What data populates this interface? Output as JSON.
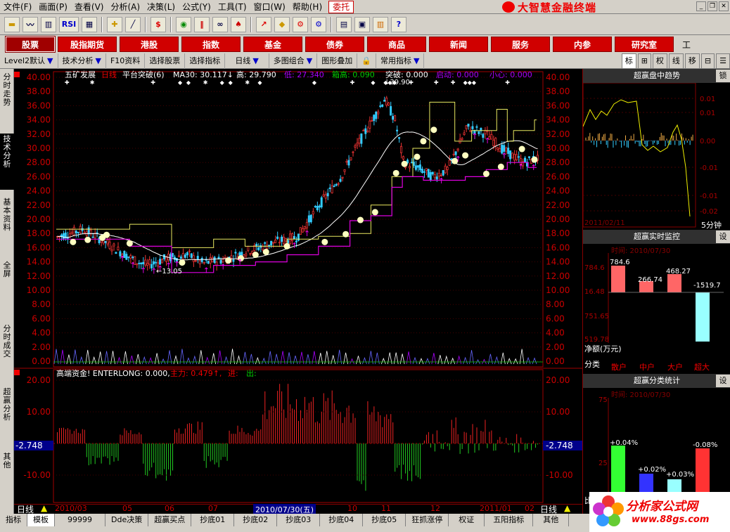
{
  "menu": {
    "items": [
      "文件(F)",
      "画面(P)",
      "查看(V)",
      "分析(A)",
      "决策(L)",
      "公式(Y)",
      "工具(T)",
      "窗口(W)",
      "帮助(H)"
    ],
    "entrust": "委托",
    "brand": "大智慧金融终端"
  },
  "toolbar": {
    "rsi": "RSI",
    "dollar": "$"
  },
  "nav": {
    "items": [
      "股票",
      "股指期货",
      "港股",
      "指数",
      "基金",
      "债券",
      "商品",
      "新闻",
      "服务",
      "内参",
      "研究室"
    ],
    "extra": "工"
  },
  "subbar": {
    "items": [
      "Level2默认",
      "技术分析",
      "F10资料",
      "选择股票",
      "选择指标",
      "日线",
      "多图组合",
      "图形叠加",
      "常用指标"
    ],
    "right": [
      "标",
      "⊞",
      "权",
      "线",
      "移",
      "⊟",
      "☰"
    ]
  },
  "side_tabs": [
    "分时走势",
    "技术分析",
    "基本资料",
    "全屏",
    "分时成交",
    "超赢分析",
    "其他"
  ],
  "chart": {
    "title": {
      "stock": "五矿发展",
      "period": "日线",
      "indicator": "平台突破(6)",
      "ma30": "MA30: 30.117↓",
      "high": "高: 29.790",
      "low": "低: 27.340",
      "box_high": "箱高: 0.090",
      "breakout": "突破: 0.000",
      "start": "启动: 0.000",
      "caution": "小心: 0.000"
    },
    "main_axis": [
      "40.00",
      "38.00",
      "36.00",
      "34.00",
      "32.00",
      "30.00",
      "28.00",
      "26.00",
      "24.00",
      "22.00",
      "20.00",
      "18.00",
      "16.00",
      "14.00",
      "12.00",
      "10.00",
      "8.00",
      "6.00",
      "4.00",
      "2.00",
      "0.00"
    ],
    "peak_label": "39.90",
    "low_label": "13.05",
    "sub_title": {
      "name": "高端资金! ENTERLONG: 0.000,",
      "main": "主力: 0.479↑,",
      "in": "进:",
      "out": "出:"
    },
    "sub_axis": [
      "20.00",
      "10.00",
      "-10.00"
    ],
    "sub_value": "-2.748",
    "x_axis": [
      "2010/03",
      "05",
      "06",
      "07",
      "2010/07/30(五)",
      "10",
      "11",
      "12",
      "2011/01",
      "02"
    ],
    "period_label": "日线"
  },
  "right_panel": {
    "trend": {
      "title": "超赢盘中趋势",
      "btn": "锁",
      "axis": [
        "0.01",
        "0.01",
        "0.00",
        "-0.01",
        "-0.01",
        "-0.02"
      ],
      "date": "2011/02/11",
      "interval": "5分钟"
    },
    "monitor": {
      "title": "超赢实时监控",
      "btn": "设",
      "time": "时间: 2010/07/30",
      "axis": [
        "784.6",
        "16.48",
        "751.65",
        "519.78"
      ],
      "values": [
        "784.6",
        "266.74",
        "468.27",
        "-1519.7"
      ],
      "net": "净额(万元)",
      "cat_label": "分类",
      "categories": [
        "散户",
        "中户",
        "大户",
        "超大"
      ]
    },
    "stats": {
      "title": "超赢分类统计",
      "btn": "设",
      "time": "时间: 2010/07/30",
      "axis": [
        "75",
        "25"
      ],
      "values": [
        "+0.04%",
        "+0.02%",
        "+0.03%",
        "-0.08%"
      ],
      "bottom_label": "比"
    }
  },
  "bottom_tabs": [
    "指标",
    "模板",
    "99999",
    "Dde决策",
    "超赢买点",
    "抄底01",
    "抄底02",
    "抄底03",
    "抄底04",
    "抄底05",
    "狂抓涨停",
    "权证",
    "五阳指标",
    "其他"
  ],
  "watermark": {
    "line1": "分析家公式网",
    "line2": "www.88gs.com"
  }
}
